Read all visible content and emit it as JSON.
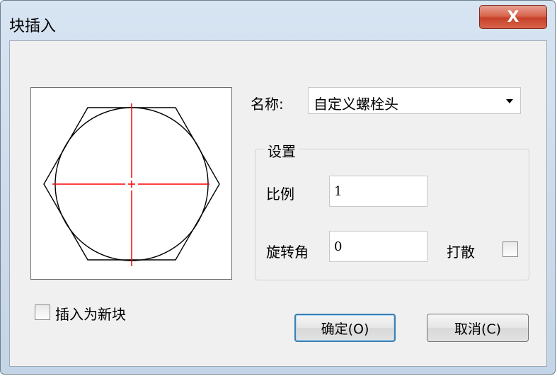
{
  "window": {
    "title": "块插入",
    "close_glyph": "X"
  },
  "name": {
    "label": "名称:",
    "value": "自定义螺栓头"
  },
  "settings": {
    "group_title": "设置",
    "scale_label": "比例",
    "scale_value": "1",
    "rotation_label": "旋转角",
    "rotation_value": "0",
    "explode_label": "打散",
    "explode_checked": false
  },
  "insert_as_new_block": {
    "label": "插入为新块",
    "checked": false
  },
  "buttons": {
    "ok": "确定(O)",
    "cancel": "取消(C)"
  },
  "preview": {
    "shape": "bolt-head",
    "outline_color": "#000000",
    "centerline_color": "#ff0000"
  },
  "colors": {
    "close_button": "#c7412a",
    "dialog_bg": "#f0f0f0",
    "frame": "#c4d5e8",
    "default_button_border": "#3c7fb1"
  }
}
